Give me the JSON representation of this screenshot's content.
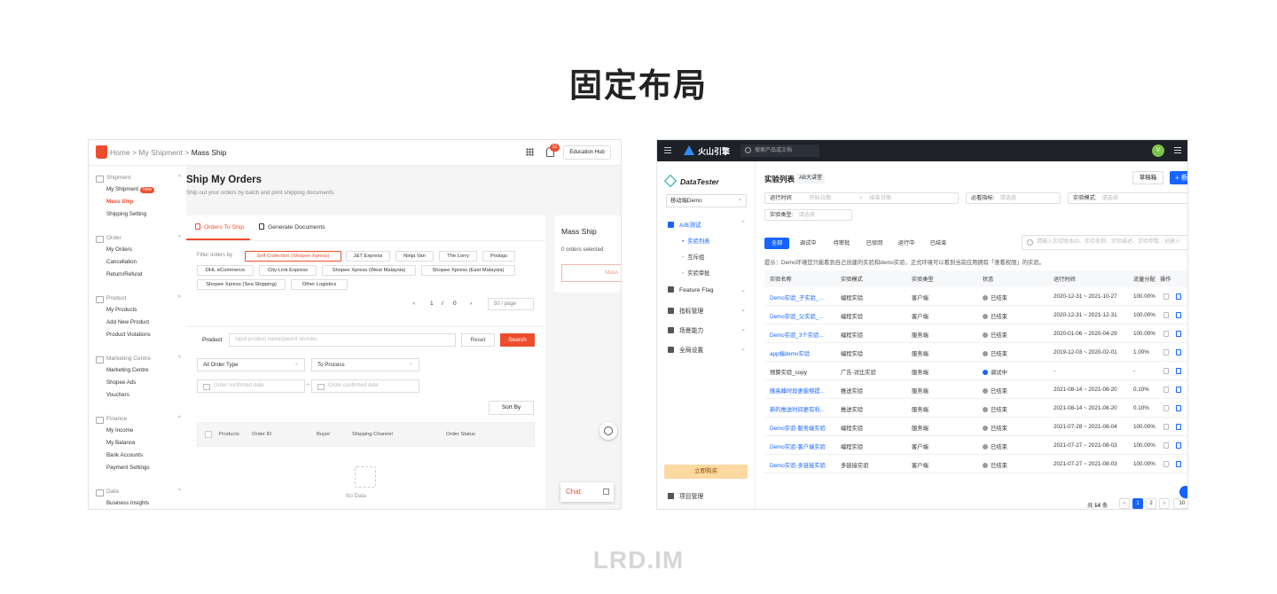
{
  "page": {
    "title": "固定布局",
    "footer": "LRD.IM"
  },
  "left": {
    "header": {
      "crumb_home": "Home",
      "crumb_mid": "My Shipment",
      "crumb_current": "Mass Ship",
      "notification_count": "11",
      "education_hub": "Education Hub"
    },
    "sidebar": [
      {
        "group": "Shipment",
        "items": [
          {
            "label": "My Shipment",
            "badge": "New"
          },
          {
            "label": "Mass Ship",
            "active": true
          },
          {
            "label": "Shipping Setting"
          }
        ]
      },
      {
        "group": "Order",
        "items": [
          {
            "label": "My Orders"
          },
          {
            "label": "Cancellation"
          },
          {
            "label": "Return/Refund"
          }
        ]
      },
      {
        "group": "Product",
        "items": [
          {
            "label": "My Products"
          },
          {
            "label": "Add New Product"
          },
          {
            "label": "Product Violations"
          }
        ]
      },
      {
        "group": "Marketing Centre",
        "items": [
          {
            "label": "Marketing Centre"
          },
          {
            "label": "Shopee Ads"
          },
          {
            "label": "Vouchers"
          }
        ]
      },
      {
        "group": "Finance",
        "items": [
          {
            "label": "My Income"
          },
          {
            "label": "My Balance"
          },
          {
            "label": "Bank Accounts"
          },
          {
            "label": "Payment Settings"
          }
        ]
      },
      {
        "group": "Data",
        "items": [
          {
            "label": "Business Insights"
          }
        ]
      }
    ],
    "main": {
      "title": "Ship My Orders",
      "subtitle": "Ship out your orders by batch and print shipping documents.",
      "tabs": [
        "Orders To Ship",
        "Generate Documents"
      ],
      "filter_label": "Filter orders by",
      "filters": [
        "Self Collection (Shopee Xpress)",
        "J&T Express",
        "Ninja Van",
        "The Lorry",
        "Poslaju",
        "DHL eCommerce",
        "City-Link Express",
        "Shopee Xpress (West Malaysia)",
        "Shopee Xpress (East Malaysia)",
        "Shopee Xpress (Sea Shipping)",
        "Other Logistics"
      ],
      "pager": {
        "page": "1",
        "sep": "/",
        "total": "0",
        "per_page": "50 / page"
      },
      "product_label": "Product",
      "product_placeholder": "Input product name/parent sku/sku",
      "reset": "Reset",
      "search": "Search",
      "order_type": "All Order Type",
      "process": "To Process",
      "date_from": "Order confirmed date",
      "date_to": "Order confirmed date",
      "date_sep": "–",
      "sort_by": "Sort By",
      "columns": [
        "Products",
        "Order ID",
        "Buyer",
        "Shipping Channel",
        "Order Status"
      ],
      "no_data": "No Data"
    },
    "mass_ship": {
      "title": "Mass Ship",
      "selected": "0 orders selected",
      "button": "Mass"
    },
    "chat": "Chat"
  },
  "right": {
    "topbar": {
      "brand": "火山引擎",
      "search_placeholder": "搜索产品或文档",
      "avatar": "V"
    },
    "sidebar": {
      "logo": "DataTester",
      "app": "移动端Demo",
      "nav": [
        {
          "label": "A/B测试",
          "active": true
        },
        {
          "label": "Feature Flag"
        },
        {
          "label": "指标管理"
        },
        {
          "label": "场景能力"
        },
        {
          "label": "全局设置"
        }
      ],
      "sub": [
        {
          "label": "实验列表",
          "active": true
        },
        {
          "label": "互斥组"
        },
        {
          "label": "实验审批"
        }
      ],
      "buy": "立即购买",
      "project": "项目管理"
    },
    "main": {
      "title": "实验列表",
      "badge": "AB大讲堂",
      "draft": "草稿箱",
      "new": "+ 新",
      "filters": {
        "run_time_label": "运行时间",
        "start_date": "开始日期",
        "range_sep": "~",
        "end_date": "结束日期",
        "metric_label": "必看指标:",
        "metric_ph": "请选择",
        "mode_label": "实验模式:",
        "mode_ph": "请选择",
        "type_label": "实验类型:",
        "type_ph": "请选择"
      },
      "tabs": [
        "全部",
        "调试中",
        "待审批",
        "已驳回",
        "运行中",
        "已结束"
      ],
      "search_placeholder": "请输入实验版本ID、实验名称、实验描述、实验参数、创建人",
      "tip": "提示：Demo环境您只能看到自己创建的实验和demo实验，正式环境可以看到当前应用拥有「查看权限」的实验。",
      "columns": [
        "实验名称",
        "实验模式",
        "实验类型",
        "状态",
        "运行时间",
        "流量分配",
        "操作"
      ],
      "rows": [
        {
          "name": "Demo实验_子实验_...",
          "mode": "编程实验",
          "type": "客户端",
          "status": "已结束",
          "time": "2020-12-31 ~ 2021-10-27",
          "traffic": "100.00%",
          "link": true
        },
        {
          "name": "Demo实验_父实验_...",
          "mode": "编程实验",
          "type": "客户端",
          "status": "已结束",
          "time": "2020-12-31 ~ 2021-12-31",
          "traffic": "100.00%",
          "link": true
        },
        {
          "name": "Demo实验_3个实验...",
          "mode": "编程实验",
          "type": "服务端",
          "status": "已结束",
          "time": "2020-01-06 ~ 2020-04-29",
          "traffic": "100.00%",
          "link": true
        },
        {
          "name": "app端demo实验",
          "mode": "编程实验",
          "type": "服务端",
          "status": "已结束",
          "time": "2019-12-03 ~ 2020-02-01",
          "traffic": "1.00%",
          "link": true
        },
        {
          "name": "预算实验_copy",
          "mode": "广告-对比实验",
          "type": "服务端",
          "status": "调试中",
          "time": "-",
          "traffic": "-",
          "link": false,
          "running": true
        },
        {
          "name": "晚高峰时段更能够提...",
          "mode": "推送实验",
          "type": "服务端",
          "status": "已结束",
          "time": "2021-08-14 ~ 2021-08-20",
          "traffic": "0.10%",
          "link": true
        },
        {
          "name": "新的推送时间更有利...",
          "mode": "推送实验",
          "type": "服务端",
          "status": "已结束",
          "time": "2021-08-14 ~ 2021-08-20",
          "traffic": "0.10%",
          "link": true
        },
        {
          "name": "Demo实验-服务端实验",
          "mode": "编程实验",
          "type": "服务端",
          "status": "已结束",
          "time": "2021-07-28 ~ 2021-08-04",
          "traffic": "100.00%",
          "link": true
        },
        {
          "name": "Demo实验-客户端实验",
          "mode": "编程实验",
          "type": "客户端",
          "status": "已结束",
          "time": "2021-07-27 ~ 2021-08-03",
          "traffic": "100.00%",
          "link": true
        },
        {
          "name": "Demo实验-多链接实验",
          "mode": "多链接实验",
          "type": "客户端",
          "status": "已结束",
          "time": "2021-07-27 ~ 2021-08-03",
          "traffic": "100.00%",
          "link": true
        }
      ],
      "pager": {
        "total_prefix": "共",
        "total": "14",
        "total_suffix": "条",
        "pages": [
          "1",
          "2"
        ],
        "per_page": "10"
      }
    }
  }
}
